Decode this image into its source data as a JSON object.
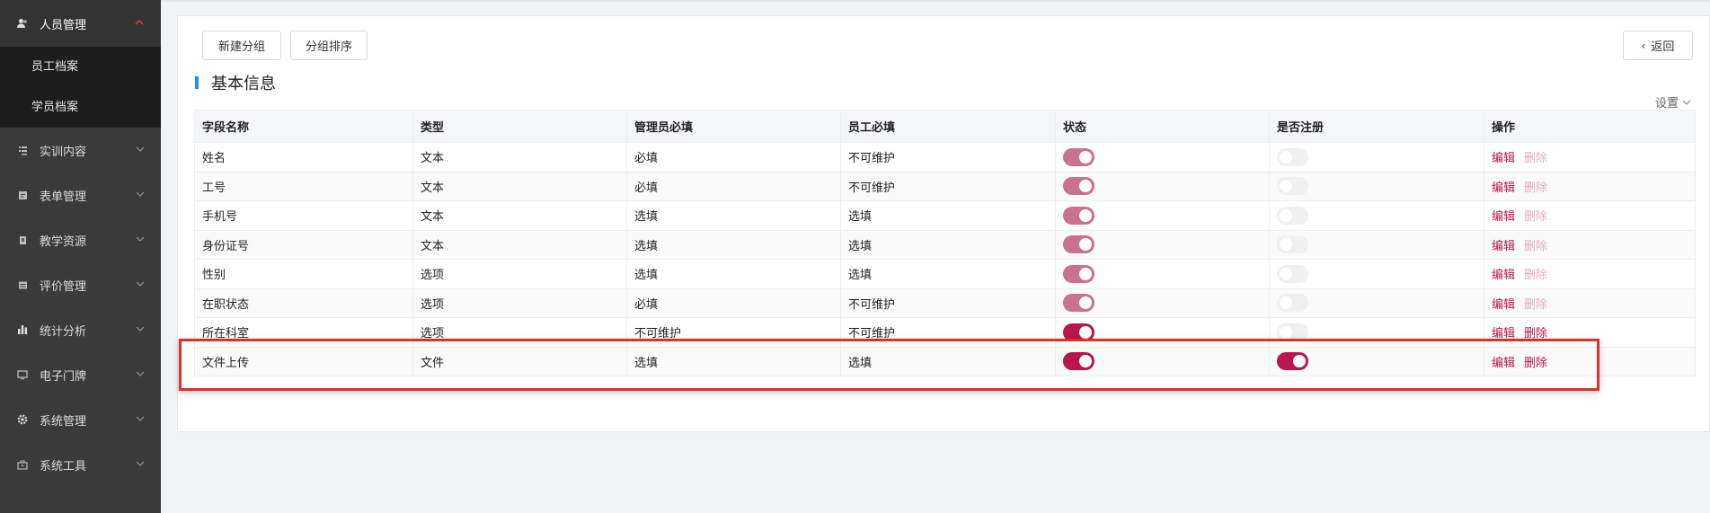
{
  "sidebar": {
    "active_group": {
      "label": "人员管理",
      "icon": "users-icon"
    },
    "sub_items": [
      {
        "label": "员工档案"
      },
      {
        "label": "学员档案"
      }
    ],
    "items": [
      {
        "label": "实训内容",
        "icon": "list-icon"
      },
      {
        "label": "表单管理",
        "icon": "form-icon"
      },
      {
        "label": "教学资源",
        "icon": "book-icon"
      },
      {
        "label": "评价管理",
        "icon": "review-icon"
      },
      {
        "label": "统计分析",
        "icon": "bar-chart-icon"
      },
      {
        "label": "电子门牌",
        "icon": "monitor-icon"
      },
      {
        "label": "系统管理",
        "icon": "gear-icon"
      },
      {
        "label": "系统工具",
        "icon": "toolbox-icon"
      }
    ]
  },
  "toolbar": {
    "new_group": "新建分组",
    "group_sort": "分组排序",
    "back": "返回"
  },
  "section": {
    "title": "基本信息",
    "settings": "设置"
  },
  "table": {
    "columns": [
      "字段名称",
      "类型",
      "管理员必填",
      "员工必填",
      "状态",
      "是否注册",
      "操作"
    ],
    "rows": [
      {
        "name": "姓名",
        "type": "文本",
        "admin_required": "必填",
        "staff_required": "不可维护",
        "status": true,
        "register": false,
        "edit": "编辑",
        "delete": "删除",
        "muted": true
      },
      {
        "name": "工号",
        "type": "文本",
        "admin_required": "必填",
        "staff_required": "不可维护",
        "status": true,
        "register": false,
        "edit": "编辑",
        "delete": "删除",
        "muted": true
      },
      {
        "name": "手机号",
        "type": "文本",
        "admin_required": "选填",
        "staff_required": "选填",
        "status": true,
        "register": false,
        "edit": "编辑",
        "delete": "删除",
        "muted": true
      },
      {
        "name": "身份证号",
        "type": "文本",
        "admin_required": "选填",
        "staff_required": "选填",
        "status": true,
        "register": false,
        "edit": "编辑",
        "delete": "删除",
        "muted": true
      },
      {
        "name": "性别",
        "type": "选项",
        "admin_required": "选填",
        "staff_required": "选填",
        "status": true,
        "register": false,
        "edit": "编辑",
        "delete": "删除",
        "muted": true
      },
      {
        "name": "在职状态",
        "type": "选项",
        "admin_required": "必填",
        "staff_required": "不可维护",
        "status": true,
        "register": false,
        "edit": "编辑",
        "delete": "删除",
        "muted": true
      },
      {
        "name": "所在科室",
        "type": "选项",
        "admin_required": "不可维护",
        "staff_required": "不可维护",
        "status": true,
        "register": false,
        "edit": "编辑",
        "delete": "删除",
        "muted": false
      },
      {
        "name": "文件上传",
        "type": "文件",
        "admin_required": "选填",
        "staff_required": "选填",
        "status": true,
        "register": true,
        "edit": "编辑",
        "delete": "删除",
        "muted": false
      }
    ]
  },
  "colors": {
    "toggle_on": "#b8164e",
    "toggle_on_muted": "#c9718f",
    "toggle_off": "#f0f0f0",
    "link": "#b8164e",
    "link_disabled": "#e0aebf",
    "highlight": "#d8322a"
  }
}
